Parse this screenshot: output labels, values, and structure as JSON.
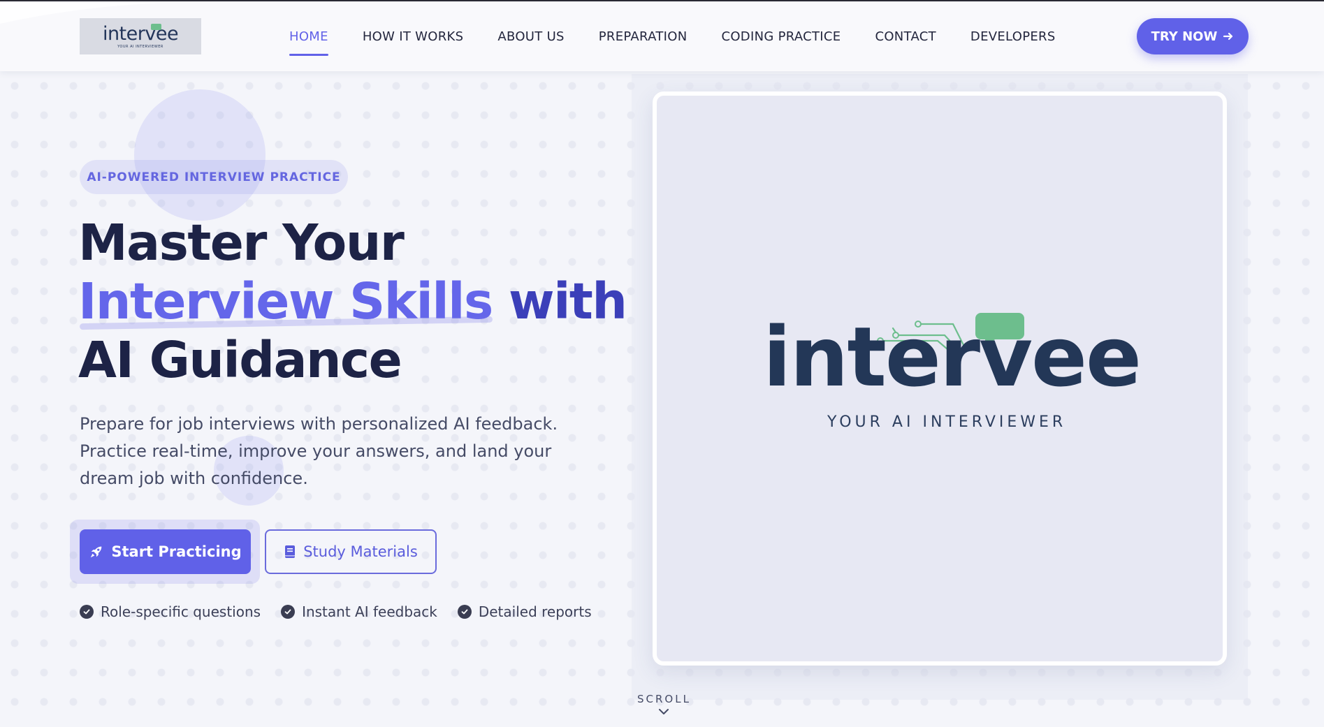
{
  "nav": {
    "logo_word": "intervee",
    "logo_tag": "YOUR AI INTERVIEWER",
    "links": [
      {
        "label": "HOME",
        "active": true
      },
      {
        "label": "HOW IT WORKS",
        "active": false
      },
      {
        "label": "ABOUT US",
        "active": false
      },
      {
        "label": "PREPARATION",
        "active": false
      },
      {
        "label": "CODING PRACTICE",
        "active": false
      },
      {
        "label": "CONTACT",
        "active": false
      },
      {
        "label": "DEVELOPERS",
        "active": false
      }
    ],
    "cta_label": "TRY NOW",
    "cta_icon": "arrow-right-icon"
  },
  "hero": {
    "badge": "AI-POWERED INTERVIEW PRACTICE",
    "headline": {
      "line1": "Master Your",
      "highlight": "Interview Skills",
      "with": "with",
      "line3": "AI Guidance"
    },
    "description": [
      "Prepare for job interviews with personalized AI feedback.",
      "Practice real-time, improve your answers, and land your",
      "dream job with confidence."
    ],
    "primary_button": {
      "label": "Start Practicing",
      "icon": "rocket-icon"
    },
    "secondary_button": {
      "label": "Study Materials",
      "icon": "book-icon"
    },
    "features": [
      "Role-specific questions",
      "Instant AI feedback",
      "Detailed reports"
    ]
  },
  "showcase": {
    "logo_word": "intervee",
    "logo_tag": "YOUR AI INTERVIEWER"
  },
  "scroll_label": "SCROLL",
  "colors": {
    "accent": "#6061e8",
    "dark": "#1d2346",
    "logo_navy": "#233757",
    "logo_green": "#6dbe8d"
  }
}
